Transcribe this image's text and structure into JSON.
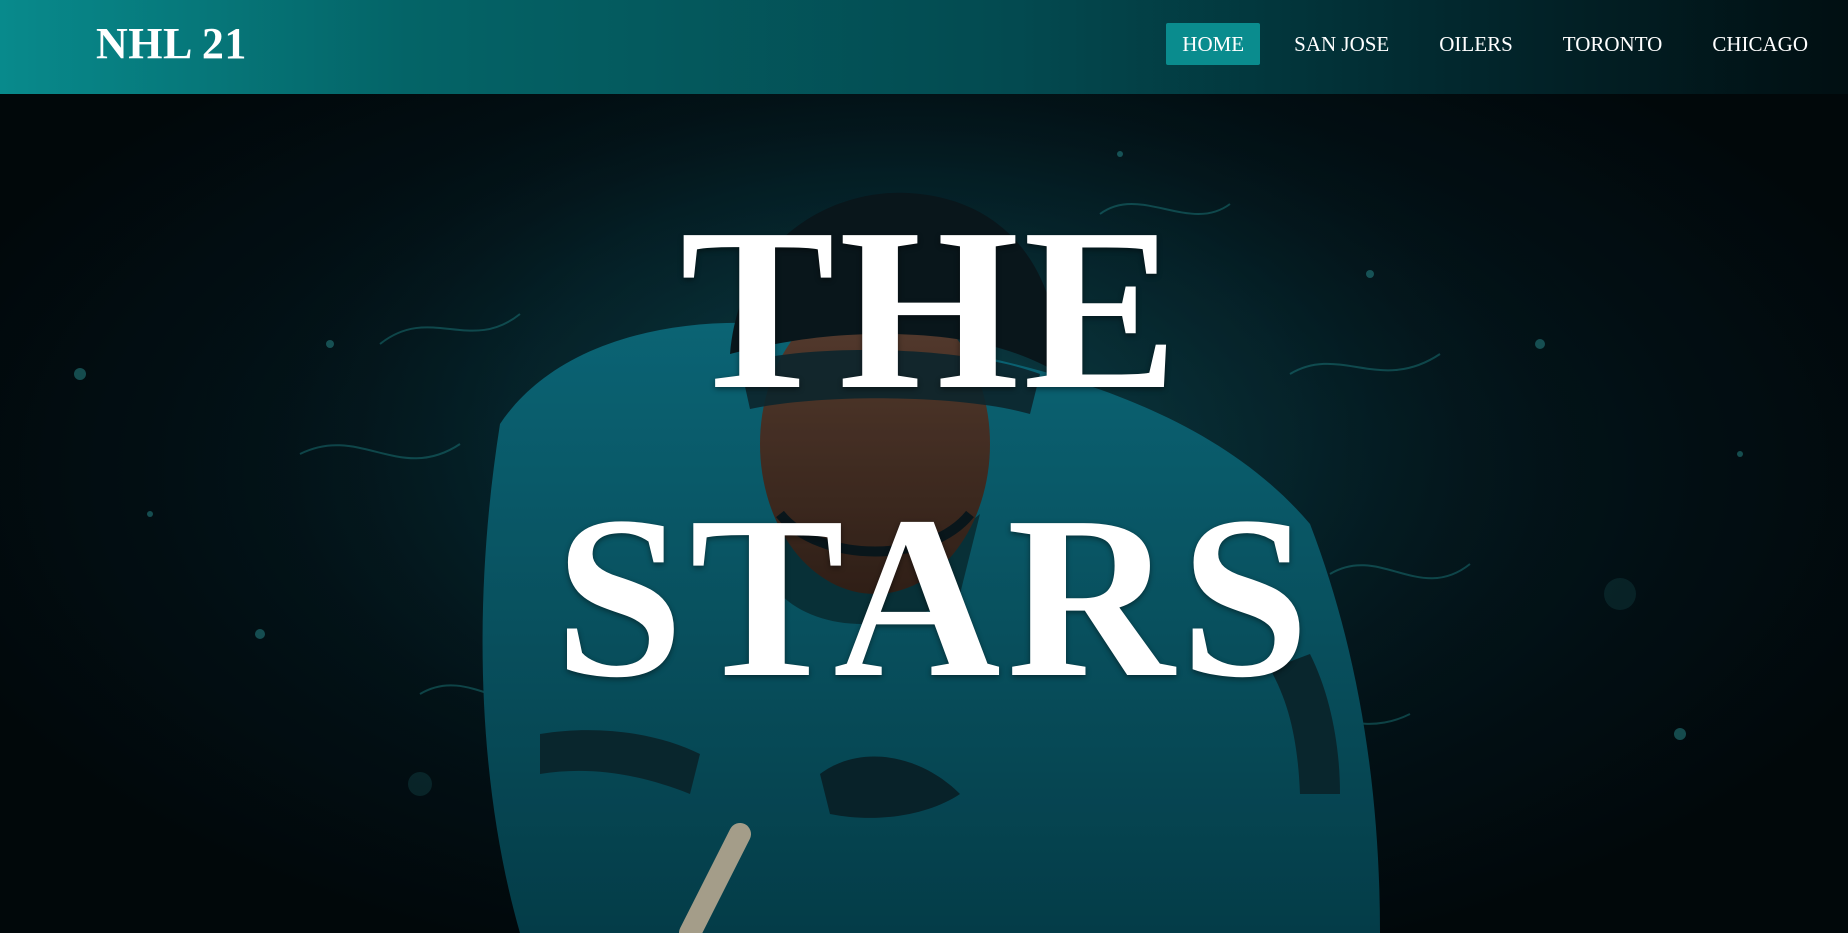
{
  "header": {
    "brand": "NHL 21",
    "nav": [
      {
        "label": "HOME",
        "active": true
      },
      {
        "label": "SAN JOSE",
        "active": false
      },
      {
        "label": "OILERS",
        "active": false
      },
      {
        "label": "TORONTO",
        "active": false
      },
      {
        "label": "CHICAGO",
        "active": false
      }
    ]
  },
  "hero": {
    "title_line_1": "THE",
    "title_line_2": "STARS",
    "image_subject": "hockey-player-jersey-number-9",
    "colors": {
      "accent": "#0a8c8e",
      "jersey_teal": "#0b6f82",
      "background_dark": "#02090c"
    }
  }
}
